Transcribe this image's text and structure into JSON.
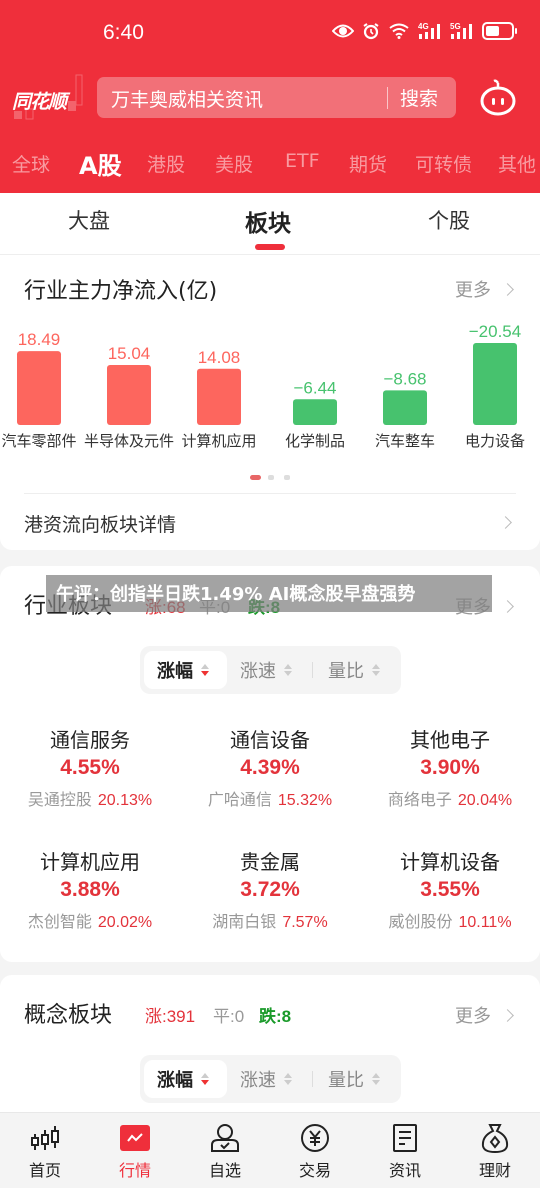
{
  "status_bar": {
    "time": "6:40",
    "icons": [
      "eye-icon",
      "alarm-icon",
      "wifi-icon",
      "signal-4g-icon",
      "signal-5g-icon",
      "battery-icon"
    ],
    "net1": "4G",
    "net2": "5G"
  },
  "header": {
    "logo": "同花顺",
    "search_placeholder": "万丰奥威相关资讯",
    "search_button": "搜索"
  },
  "market_tabs": [
    {
      "label": "全球",
      "active": false
    },
    {
      "label": "A股",
      "active": true
    },
    {
      "label": "港股",
      "active": false
    },
    {
      "label": "美股",
      "active": false
    },
    {
      "label": "ETF",
      "active": false
    },
    {
      "label": "期货",
      "active": false
    },
    {
      "label": "可转债",
      "active": false
    },
    {
      "label": "其他",
      "active": false
    }
  ],
  "sub_tabs": [
    {
      "label": "大盘",
      "active": false
    },
    {
      "label": "板块",
      "active": true
    },
    {
      "label": "个股",
      "active": false
    }
  ],
  "flow_card": {
    "title": "行业主力净流入(亿)",
    "more": "更多",
    "link": "港资流向板块详情",
    "page_indicator": {
      "count": 3,
      "active": 0
    }
  },
  "chart_data": {
    "type": "bar",
    "title": "行业主力净流入(亿)",
    "categories": [
      "汽车零部件",
      "半导体及元件",
      "计算机应用",
      "化学制品",
      "汽车整车",
      "电力设备"
    ],
    "values": [
      18.49,
      15.04,
      14.08,
      -6.44,
      -8.68,
      -20.54
    ],
    "value_labels": [
      "18.49",
      "15.04",
      "14.08",
      "−6.44",
      "−8.68",
      "−20.54"
    ],
    "bar_height_by": "absolute value",
    "colors": {
      "positive": "#fd665e",
      "negative": "#47c26e"
    },
    "xlabel": "",
    "ylabel": "",
    "grid": false
  },
  "industry_card": {
    "title": "行业板块",
    "up_label": "涨:68",
    "flat_label": "平:0",
    "down_label": "跌:8",
    "more": "更多",
    "sort_options": [
      {
        "label": "涨幅",
        "active": true
      },
      {
        "label": "涨速",
        "active": false
      },
      {
        "label": "量比",
        "active": false
      }
    ],
    "items": [
      {
        "name": "通信服务",
        "pct": "4.55%",
        "leader": "吴通控股",
        "leader_pct": "20.13%"
      },
      {
        "name": "通信设备",
        "pct": "4.39%",
        "leader": "广哈通信",
        "leader_pct": "15.32%"
      },
      {
        "name": "其他电子",
        "pct": "3.90%",
        "leader": "商络电子",
        "leader_pct": "20.04%"
      },
      {
        "name": "计算机应用",
        "pct": "3.88%",
        "leader": "杰创智能",
        "leader_pct": "20.02%"
      },
      {
        "name": "贵金属",
        "pct": "3.72%",
        "leader": "湖南白银",
        "leader_pct": "7.57%"
      },
      {
        "name": "计算机设备",
        "pct": "3.55%",
        "leader": "威创股份",
        "leader_pct": "10.11%"
      }
    ]
  },
  "concept_card": {
    "title": "概念板块",
    "up_label": "涨:391",
    "flat_label": "平:0",
    "down_label": "跌:8",
    "more": "更多",
    "sort_options": [
      {
        "label": "涨幅",
        "active": true
      },
      {
        "label": "涨速",
        "active": false
      },
      {
        "label": "量比",
        "active": false
      }
    ]
  },
  "overlay_headline": "午评：创指半日跌1.49% AI概念股早盘强势",
  "bottom_nav": [
    {
      "label": "首页",
      "icon": "candlestick-icon",
      "active": false
    },
    {
      "label": "行情",
      "icon": "market-chart-icon",
      "active": true
    },
    {
      "label": "自选",
      "icon": "user-check-icon",
      "active": false
    },
    {
      "label": "交易",
      "icon": "yen-coin-icon",
      "active": false
    },
    {
      "label": "资讯",
      "icon": "document-icon",
      "active": false
    },
    {
      "label": "理财",
      "icon": "money-bag-icon",
      "active": false
    }
  ],
  "colors": {
    "brand_red": "#ef2f3b",
    "up_red": "#e3333b",
    "down_green": "#1a9a2a"
  }
}
